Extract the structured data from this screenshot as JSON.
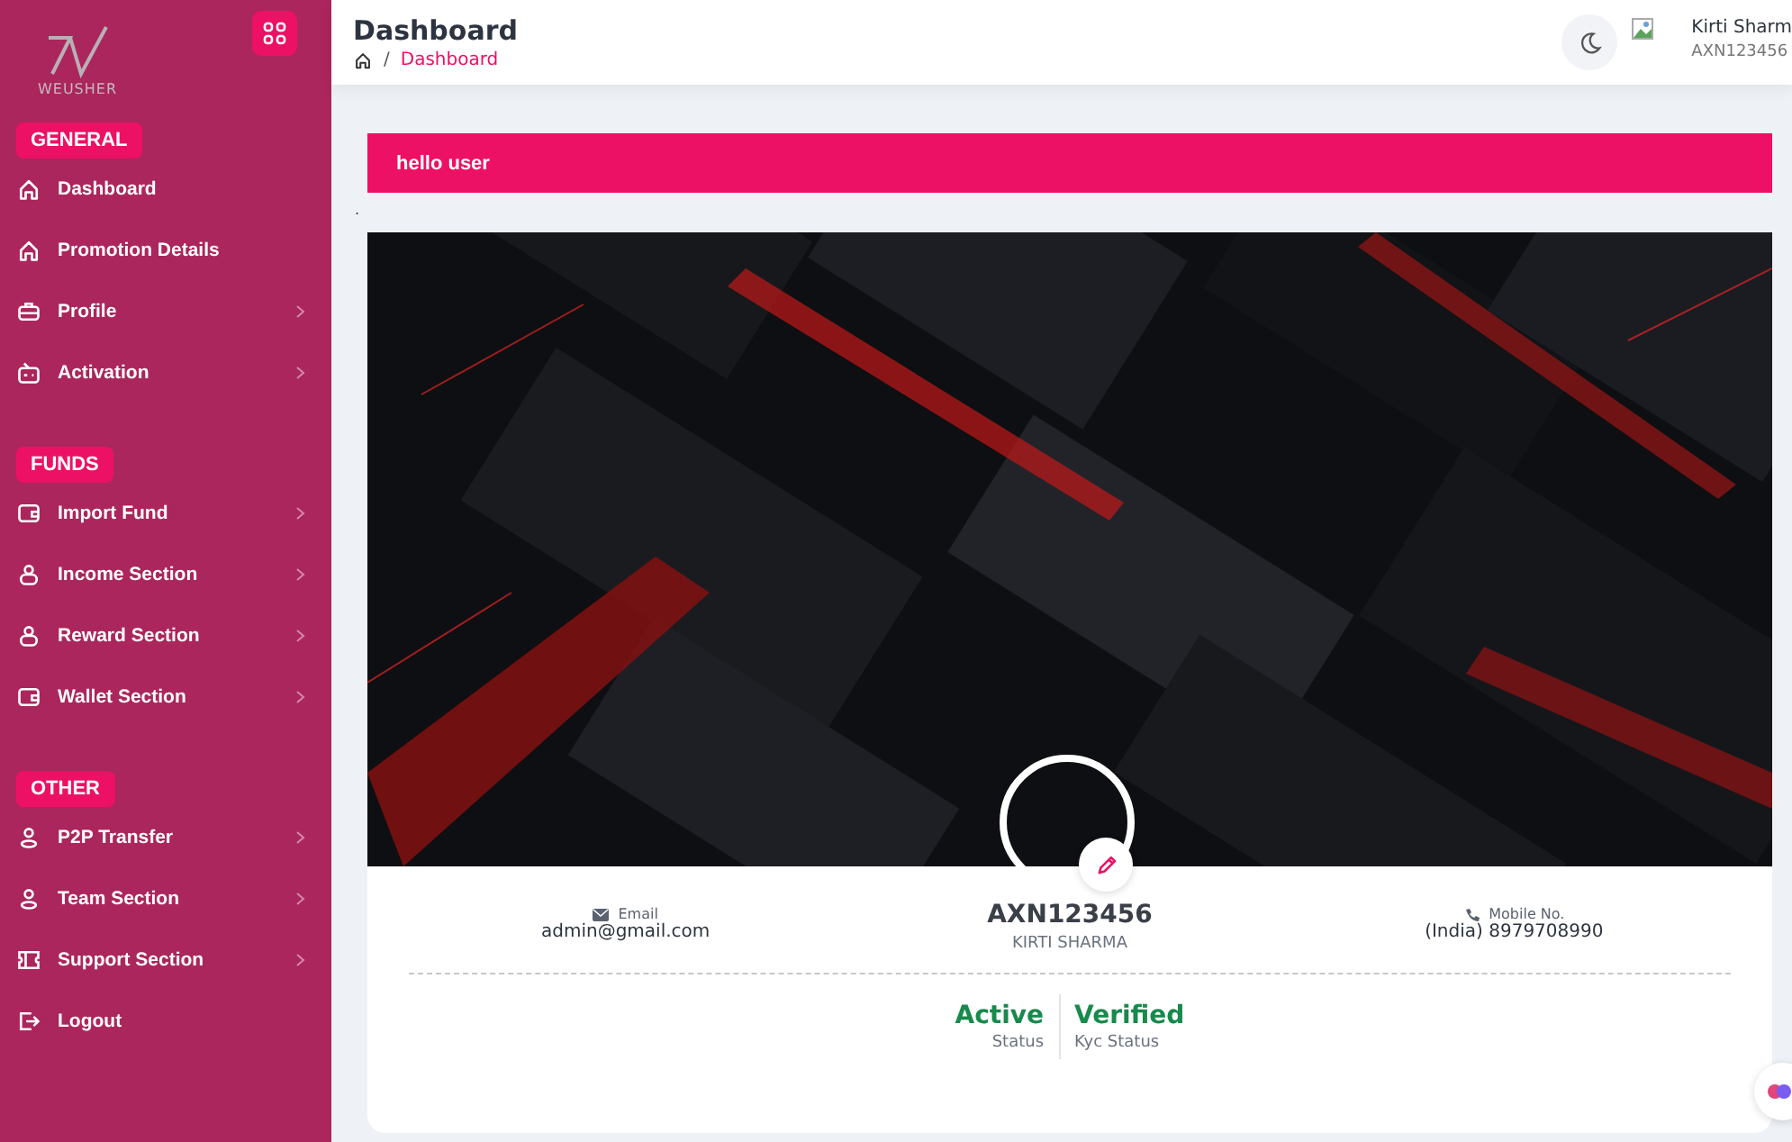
{
  "sidebar": {
    "logo": "WEUSHER",
    "sections": [
      {
        "label": "GENERAL",
        "items": [
          {
            "label": "Dashboard",
            "has_submenu": false
          },
          {
            "label": "Promotion Details",
            "has_submenu": false
          },
          {
            "label": "Profile",
            "has_submenu": true
          },
          {
            "label": "Activation",
            "has_submenu": true
          }
        ]
      },
      {
        "label": "FUNDS",
        "items": [
          {
            "label": "Import Fund",
            "has_submenu": true
          },
          {
            "label": "Income Section",
            "has_submenu": true
          },
          {
            "label": "Reward Section",
            "has_submenu": true
          },
          {
            "label": "Wallet Section",
            "has_submenu": true
          }
        ]
      },
      {
        "label": "OTHER",
        "items": [
          {
            "label": "P2P Transfer",
            "has_submenu": true
          },
          {
            "label": "Team Section",
            "has_submenu": true
          },
          {
            "label": "Support Section",
            "has_submenu": true
          },
          {
            "label": "Logout",
            "has_submenu": false
          }
        ]
      }
    ]
  },
  "header": {
    "title": "Dashboard",
    "breadcrumb": {
      "separator": "/",
      "current": "Dashboard"
    },
    "user": {
      "name": "Kirti Sharm",
      "id": "AXN123456"
    }
  },
  "banner": {
    "text": "hello user"
  },
  "stray_mark": ".",
  "profile": {
    "email_label": "Email",
    "email": "admin@gmail.com",
    "user_id": "AXN123456",
    "full_name": "KIRTI SHARMA",
    "mobile_label": "Mobile No.",
    "mobile": "(India) 8979708990",
    "statuses": [
      {
        "value": "Active",
        "label": "Status"
      },
      {
        "value": "Verified",
        "label": "Kyc Status"
      }
    ]
  }
}
